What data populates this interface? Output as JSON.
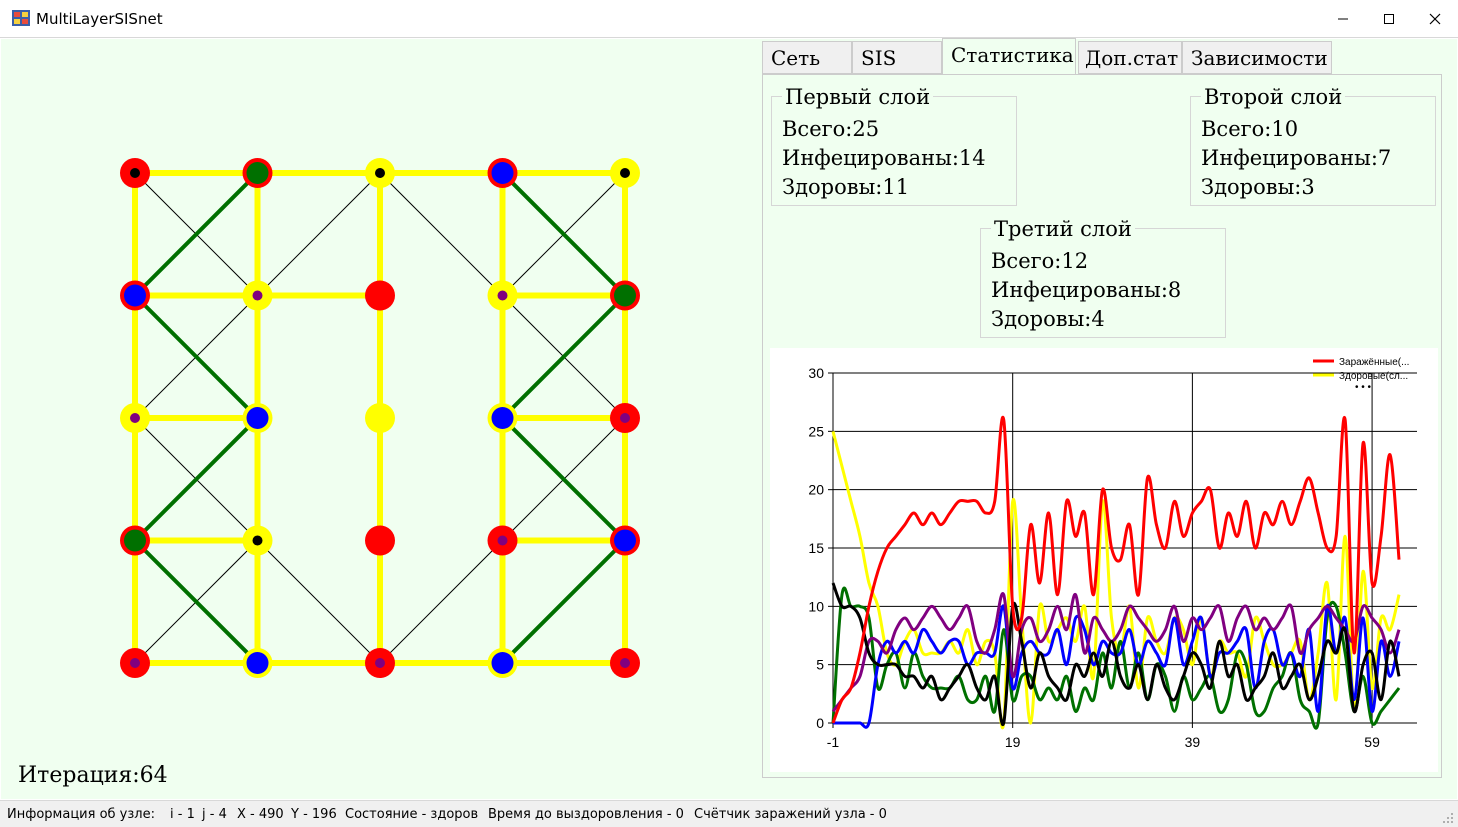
{
  "window": {
    "title": "MultiLayerSISnet",
    "minimize_glyph": "—",
    "maximize_glyph": "☐",
    "close_glyph": "✕"
  },
  "tabs": [
    {
      "label": "Сеть",
      "active": false
    },
    {
      "label": "SIS",
      "active": false
    },
    {
      "label": "Статистика",
      "active": true
    },
    {
      "label": "Доп.стат",
      "active": false
    },
    {
      "label": "Зависимости",
      "active": false
    }
  ],
  "stats": {
    "layer1": {
      "title": "Первый слой",
      "total": "Всего:25",
      "infected": "Инфецированы:14",
      "healthy": "Здоровы:11"
    },
    "layer2": {
      "title": "Второй слой",
      "total": "Всего:10",
      "infected": "Инфецированы:7",
      "healthy": "Здоровы:3"
    },
    "layer3": {
      "title": "Третий слой",
      "total": "Всего:12",
      "infected": "Инфецированы:8",
      "healthy": "Здоровы:4"
    }
  },
  "iteration_label": "Итерация:64",
  "status": {
    "label": "Информация об узле:",
    "i": "i - 1",
    "j": "j - 4",
    "x": "X - 490",
    "y": "Y - 196",
    "state": "Состояние - здоров",
    "recovery": "Время до выздоровления - 0",
    "counter": "Счётчик заражений узла - 0"
  },
  "colors": {
    "red": "#ff0000",
    "yellow": "#ffff00",
    "blue": "#0000ff",
    "green": "#007000",
    "purple": "#800080",
    "black": "#000000",
    "edge_layer1": "#ffff00",
    "edge_layer2": "#007000",
    "edge_layer3": "#000000"
  },
  "network": {
    "grid_cols": 5,
    "grid_rows": 5,
    "nodes": [
      {
        "c": 0,
        "r": 0,
        "outer": "red",
        "inner": "black"
      },
      {
        "c": 1,
        "r": 0,
        "outer": "red",
        "inner": "green"
      },
      {
        "c": 2,
        "r": 0,
        "outer": "yellow",
        "inner": "black"
      },
      {
        "c": 3,
        "r": 0,
        "outer": "red",
        "inner": "blue"
      },
      {
        "c": 4,
        "r": 0,
        "outer": "yellow",
        "inner": "black"
      },
      {
        "c": 0,
        "r": 1,
        "outer": "red",
        "inner": "blue"
      },
      {
        "c": 1,
        "r": 1,
        "outer": "yellow",
        "inner": "purple"
      },
      {
        "c": 2,
        "r": 1,
        "outer": "red",
        "inner": "red"
      },
      {
        "c": 3,
        "r": 1,
        "outer": "yellow",
        "inner": "purple"
      },
      {
        "c": 4,
        "r": 1,
        "outer": "red",
        "inner": "green"
      },
      {
        "c": 0,
        "r": 2,
        "outer": "yellow",
        "inner": "purple"
      },
      {
        "c": 1,
        "r": 2,
        "outer": "yellow",
        "inner": "blue"
      },
      {
        "c": 2,
        "r": 2,
        "outer": "yellow",
        "inner": "yellow"
      },
      {
        "c": 3,
        "r": 2,
        "outer": "yellow",
        "inner": "blue"
      },
      {
        "c": 4,
        "r": 2,
        "outer": "red",
        "inner": "purple"
      },
      {
        "c": 0,
        "r": 3,
        "outer": "red",
        "inner": "green"
      },
      {
        "c": 1,
        "r": 3,
        "outer": "yellow",
        "inner": "black"
      },
      {
        "c": 2,
        "r": 3,
        "outer": "red",
        "inner": "red"
      },
      {
        "c": 3,
        "r": 3,
        "outer": "red",
        "inner": "purple"
      },
      {
        "c": 4,
        "r": 3,
        "outer": "red",
        "inner": "blue"
      },
      {
        "c": 0,
        "r": 4,
        "outer": "red",
        "inner": "purple"
      },
      {
        "c": 1,
        "r": 4,
        "outer": "yellow",
        "inner": "blue"
      },
      {
        "c": 2,
        "r": 4,
        "outer": "red",
        "inner": "purple"
      },
      {
        "c": 3,
        "r": 4,
        "outer": "yellow",
        "inner": "blue"
      },
      {
        "c": 4,
        "r": 4,
        "outer": "red",
        "inner": "purple"
      }
    ],
    "edges_layer1": [
      [
        [
          0,
          0
        ],
        [
          4,
          0
        ]
      ],
      [
        [
          0,
          4
        ],
        [
          4,
          4
        ]
      ],
      [
        [
          0,
          1
        ],
        [
          2,
          1
        ]
      ],
      [
        [
          3,
          1
        ],
        [
          4,
          1
        ]
      ],
      [
        [
          0,
          2
        ],
        [
          1,
          2
        ]
      ],
      [
        [
          3,
          2
        ],
        [
          4,
          2
        ]
      ],
      [
        [
          0,
          3
        ],
        [
          1,
          3
        ]
      ],
      [
        [
          3,
          3
        ],
        [
          4,
          3
        ]
      ],
      [
        [
          0,
          0
        ],
        [
          0,
          4
        ]
      ],
      [
        [
          1,
          0
        ],
        [
          1,
          4
        ]
      ],
      [
        [
          2,
          0
        ],
        [
          2,
          4
        ]
      ],
      [
        [
          3,
          0
        ],
        [
          3,
          4
        ]
      ],
      [
        [
          4,
          0
        ],
        [
          4,
          4
        ]
      ]
    ],
    "edges_layer2": [
      [
        [
          0,
          1
        ],
        [
          1,
          0
        ]
      ],
      [
        [
          0,
          1
        ],
        [
          1,
          2
        ]
      ],
      [
        [
          1,
          2
        ],
        [
          0,
          3
        ]
      ],
      [
        [
          0,
          3
        ],
        [
          1,
          4
        ]
      ],
      [
        [
          3,
          0
        ],
        [
          4,
          1
        ]
      ],
      [
        [
          4,
          1
        ],
        [
          3,
          2
        ]
      ],
      [
        [
          3,
          2
        ],
        [
          4,
          3
        ]
      ],
      [
        [
          4,
          3
        ],
        [
          3,
          4
        ]
      ]
    ],
    "edges_layer3": [
      [
        [
          0,
          0
        ],
        [
          1,
          1
        ]
      ],
      [
        [
          1,
          1
        ],
        [
          2,
          0
        ]
      ],
      [
        [
          2,
          0
        ],
        [
          4,
          2
        ]
      ],
      [
        [
          3,
          1
        ],
        [
          4,
          0
        ]
      ],
      [
        [
          0,
          2
        ],
        [
          1,
          1
        ]
      ],
      [
        [
          0,
          2
        ],
        [
          1,
          3
        ]
      ],
      [
        [
          1,
          3
        ],
        [
          2,
          4
        ]
      ],
      [
        [
          2,
          4
        ],
        [
          4,
          2
        ]
      ],
      [
        [
          0,
          4
        ],
        [
          1,
          3
        ]
      ]
    ]
  },
  "chart_data": {
    "type": "line",
    "x_start": -1,
    "xticks": [
      -1,
      19,
      39,
      59
    ],
    "yticks": [
      0,
      5,
      10,
      15,
      20,
      25,
      30
    ],
    "xlim": [
      -1,
      64
    ],
    "ylim": [
      0,
      30
    ],
    "grid": true,
    "legend_position": "top-right",
    "legend_entries": [
      "Заражённые(...",
      "Здоровые(сл...",
      "• • •"
    ],
    "series": [
      {
        "color": "red",
        "values": [
          0,
          2,
          3,
          6,
          10,
          13,
          15,
          16,
          17,
          18,
          17,
          18,
          17,
          18,
          19,
          19,
          19,
          18,
          19,
          26,
          10,
          9,
          17,
          12,
          18,
          11,
          19,
          16,
          18,
          11,
          20,
          15,
          14,
          17,
          11,
          21,
          17,
          15,
          19,
          16,
          18,
          19,
          20,
          15,
          18,
          16,
          19,
          15,
          18,
          17,
          19,
          17,
          19,
          21,
          18,
          15,
          16,
          26,
          6,
          24,
          12,
          16,
          23,
          14
        ]
      },
      {
        "color": "yellow",
        "values": [
          25,
          22,
          19,
          16,
          12,
          10,
          6,
          5,
          7,
          8,
          6,
          6,
          6,
          7,
          6,
          8,
          5,
          7,
          6,
          0,
          19,
          9,
          0,
          10,
          7,
          8,
          9,
          7,
          10,
          4,
          19,
          9,
          6,
          10,
          3,
          9,
          7,
          6,
          9,
          8,
          5,
          9,
          4,
          7,
          6,
          6,
          4,
          9,
          7,
          5,
          5,
          6,
          7,
          2,
          6,
          12,
          2,
          16,
          1,
          13,
          3,
          9,
          8,
          11
        ]
      },
      {
        "color": "green",
        "values": [
          0,
          11,
          10,
          10,
          9,
          3,
          5,
          6,
          3,
          6,
          4,
          3,
          3,
          3,
          4,
          2,
          2,
          4,
          1,
          8,
          2,
          4,
          4,
          2,
          3,
          2,
          4,
          1,
          3,
          2,
          6,
          3,
          7,
          3,
          6,
          2,
          5,
          4,
          1,
          4,
          2,
          3,
          4,
          1,
          2,
          6,
          5,
          1,
          1,
          3,
          4,
          6,
          2,
          1,
          0,
          9,
          10,
          6,
          1,
          4,
          0,
          1,
          2,
          3
        ]
      },
      {
        "color": "blue",
        "values": [
          0,
          0,
          0,
          0,
          0,
          5,
          7,
          6,
          7,
          6,
          8,
          7,
          6,
          7,
          7,
          5,
          6,
          6,
          6,
          10,
          3,
          6,
          7,
          6,
          6,
          8,
          5,
          9,
          8,
          5,
          7,
          6,
          6,
          8,
          5,
          7,
          6,
          5,
          9,
          5,
          7,
          9,
          4,
          6,
          6,
          7,
          8,
          3,
          7,
          8,
          5,
          6,
          4,
          8,
          1,
          10,
          6,
          9,
          2,
          9,
          1,
          7,
          4,
          7
        ]
      },
      {
        "color": "purple",
        "values": [
          1,
          2,
          3,
          4,
          7,
          7,
          6,
          8,
          9,
          8,
          9,
          10,
          9,
          8,
          9,
          10,
          7,
          6,
          8,
          11,
          4,
          8,
          9,
          7,
          8,
          10,
          8,
          11,
          6,
          9,
          8,
          7,
          8,
          10,
          9,
          8,
          7,
          8,
          10,
          7,
          9,
          8,
          9,
          10,
          7,
          9,
          10,
          8,
          9,
          8,
          9,
          10,
          6,
          8,
          9,
          10,
          9,
          8,
          7,
          10,
          9,
          8,
          6,
          8
        ]
      },
      {
        "color": "black",
        "values": [
          12,
          10,
          10,
          9,
          6,
          5,
          5,
          5,
          4,
          4,
          3,
          4,
          2,
          3,
          4,
          5,
          3,
          2,
          4,
          0,
          10,
          7,
          3,
          6,
          4,
          3,
          2,
          5,
          4,
          6,
          4,
          7,
          4,
          3,
          5,
          2,
          5,
          3,
          2,
          4,
          6,
          5,
          3,
          7,
          4,
          5,
          2,
          3,
          4,
          6,
          3,
          4,
          5,
          2,
          4,
          7,
          6,
          8,
          1,
          5,
          6,
          2,
          7,
          4
        ]
      }
    ]
  }
}
